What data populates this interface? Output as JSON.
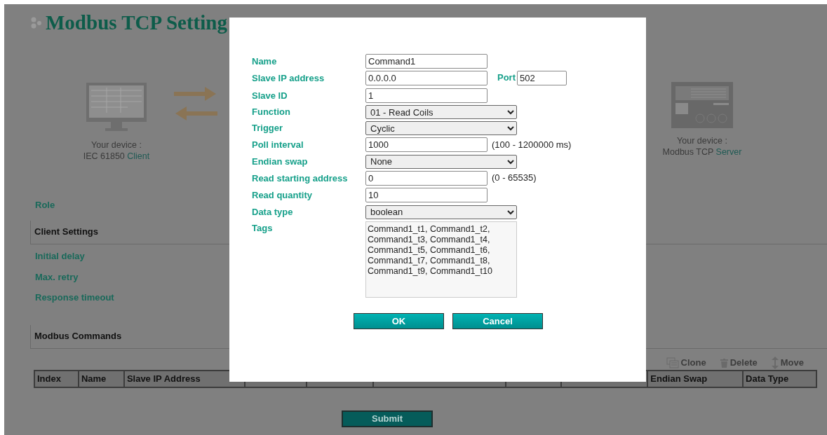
{
  "page": {
    "title": "Modbus TCP Setting",
    "client_device": {
      "caption": "Your device :",
      "protocol": "IEC 61850",
      "role": "Client"
    },
    "server_device": {
      "caption": "Your device :",
      "protocol": "Modbus TCP",
      "role": "Server"
    },
    "role_label": "Role",
    "client_settings": {
      "heading": "Client Settings",
      "labels": [
        "Initial delay",
        "Max. retry",
        "Response timeout"
      ]
    },
    "modbus_commands": {
      "heading": "Modbus Commands",
      "toolbar": [
        "Clone",
        "Delete",
        "Move"
      ],
      "columns": [
        "Index",
        "Name",
        "Slave IP Address",
        "",
        "",
        "",
        "",
        "",
        "Endian Swap",
        "Data Type"
      ]
    },
    "submit": "Submit"
  },
  "dialog": {
    "fields": [
      {
        "kind": "text",
        "label": "Name",
        "value": "Command1"
      },
      {
        "kind": "text",
        "label": "Slave IP address",
        "value": "0.0.0.0",
        "extra_label": "Port",
        "extra_value": "502"
      },
      {
        "kind": "text",
        "label": "Slave ID",
        "value": "1"
      },
      {
        "kind": "select",
        "label": "Function",
        "value": "01 - Read Coils"
      },
      {
        "kind": "select",
        "label": "Trigger",
        "value": "Cyclic"
      },
      {
        "kind": "text",
        "label": "Poll interval",
        "value": "1000",
        "hint": "(100 - 1200000 ms)"
      },
      {
        "kind": "select",
        "label": "Endian swap",
        "value": "None"
      },
      {
        "kind": "text",
        "label": "Read starting address",
        "value": "0",
        "hint": "(0 - 65535)"
      },
      {
        "kind": "text",
        "label": "Read quantity",
        "value": "10"
      },
      {
        "kind": "select",
        "label": "Data type",
        "value": "boolean"
      },
      {
        "kind": "textarea",
        "label": "Tags",
        "value": "Command1_t1, Command1_t2,\nCommand1_t3, Command1_t4,\nCommand1_t5, Command1_t6,\nCommand1_t7, Command1_t8,\nCommand1_t9, Command1_t10"
      }
    ],
    "buttons": [
      "OK",
      "Cancel"
    ]
  }
}
